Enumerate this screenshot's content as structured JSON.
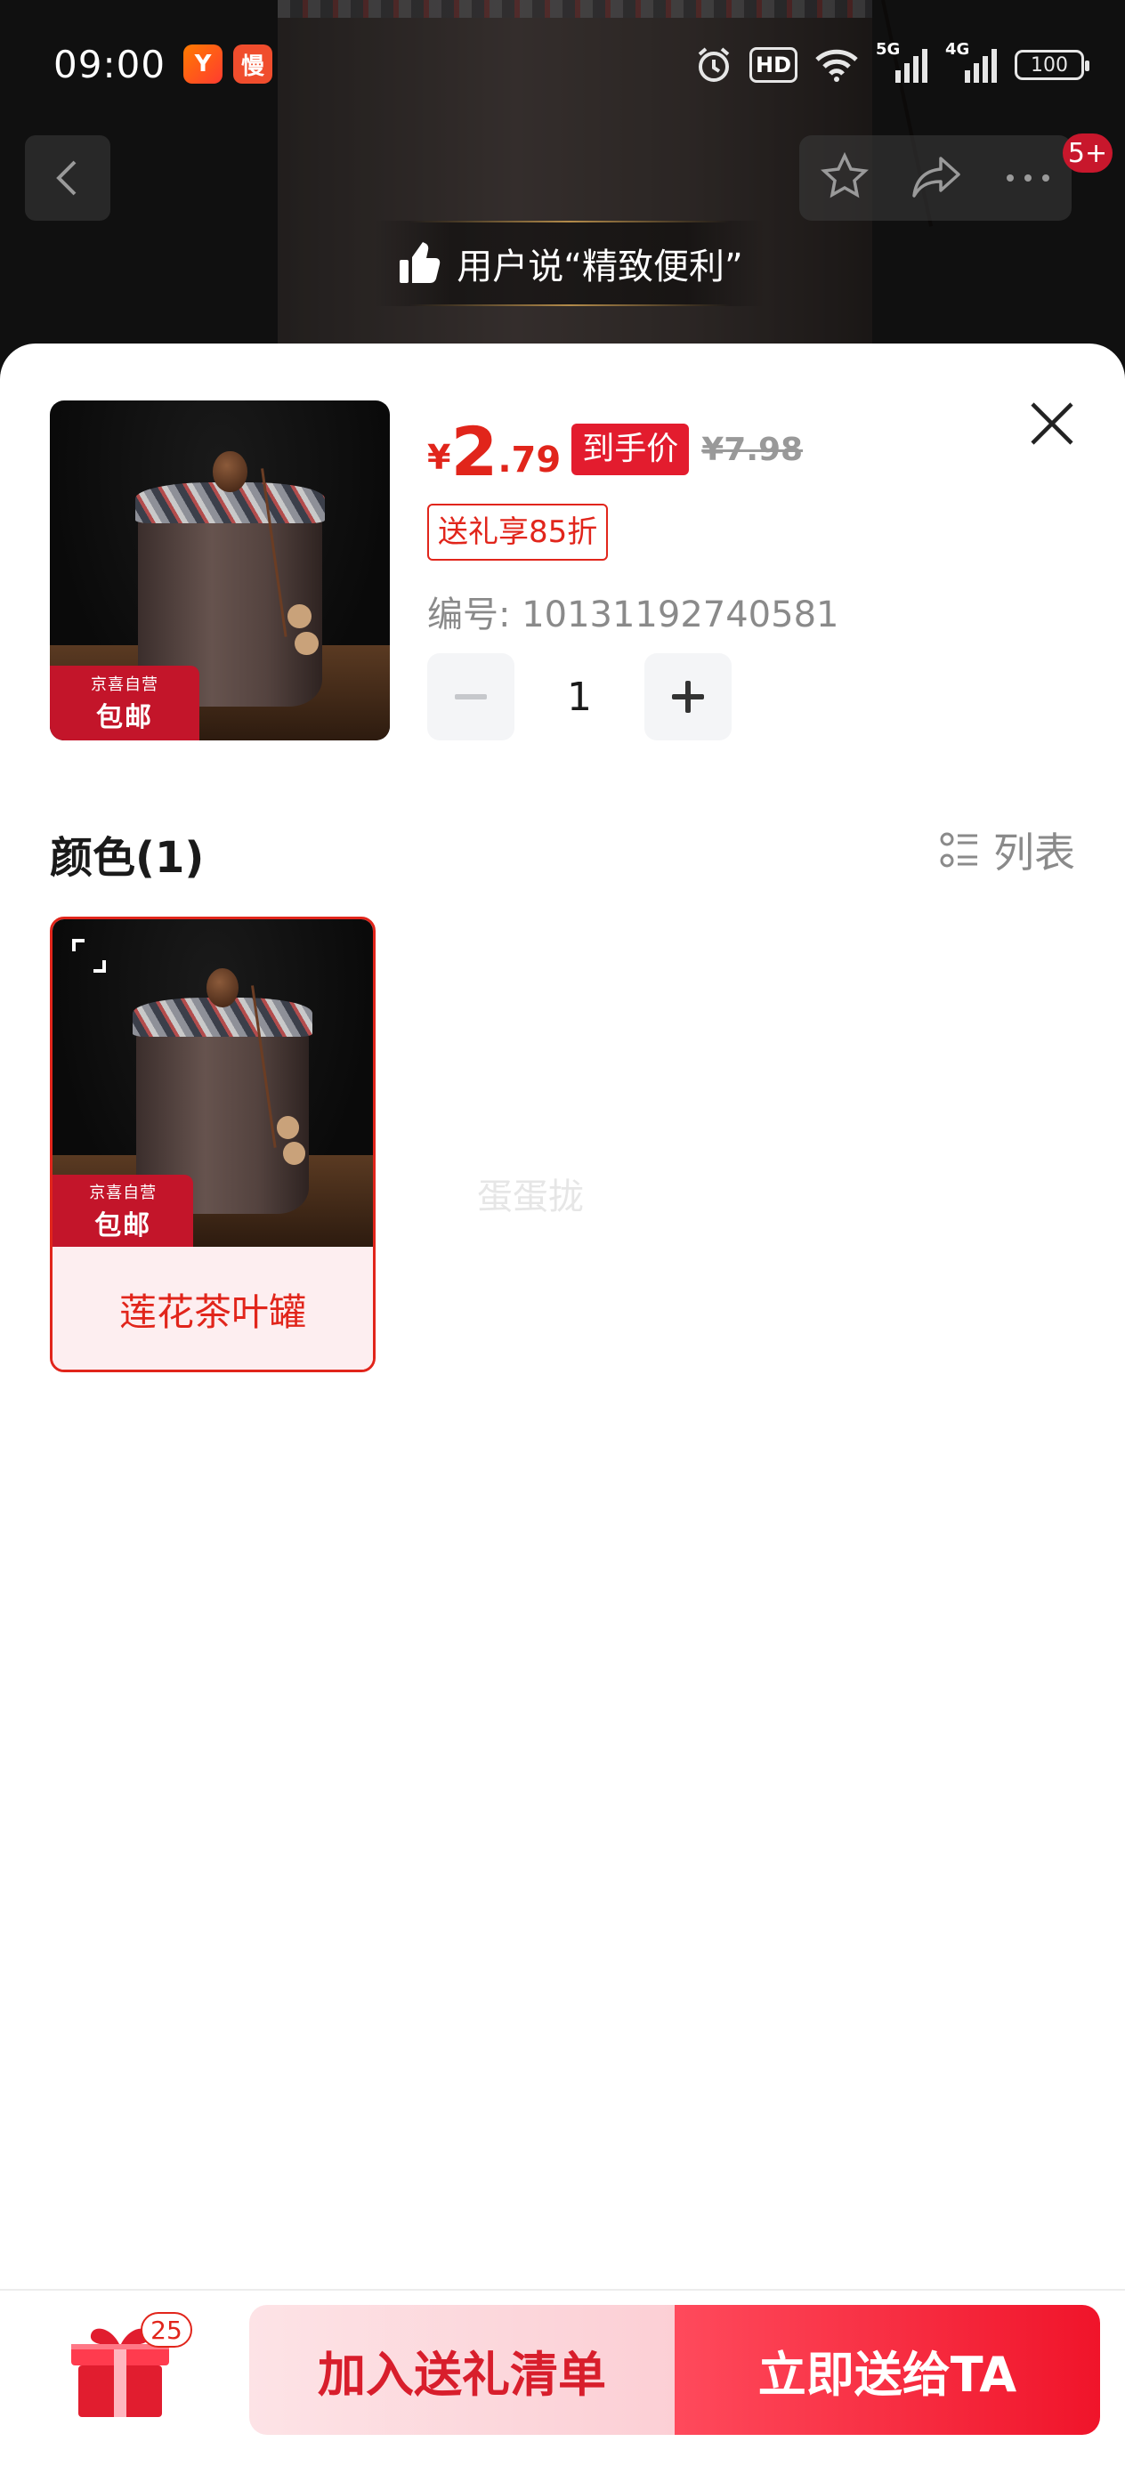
{
  "status_bar": {
    "time": "09:00",
    "app_badge_1": "Y",
    "app_badge_2": "慢",
    "network_5g": "5G",
    "network_4g": "4G",
    "hd_label": "HD",
    "battery": "100"
  },
  "header": {
    "message_badge": "5+",
    "praise_text": "用户说“精致便利”"
  },
  "product": {
    "currency": "¥",
    "price_int": "2",
    "price_dec": ".79",
    "final_price_tag": "到手价",
    "original_price": "¥7.98",
    "discount_badge": "送礼享85折",
    "sku_label": "编号: 10131192740581",
    "quantity": "1",
    "thumb_tag_line1": "京喜自营",
    "thumb_tag_line2": "包邮"
  },
  "options": {
    "section_title": "颜色(1)",
    "list_toggle_label": "列表",
    "items": [
      {
        "label": "莲花茶叶罐",
        "tag_line1": "京喜自营",
        "tag_line2": "包邮"
      }
    ]
  },
  "watermark": "蛋蛋拢",
  "bottom_bar": {
    "gift_count": "25",
    "add_to_gift_list": "加入送礼清单",
    "send_now": "立即送给TA"
  },
  "colors": {
    "accent_red": "#e1251b",
    "button_gradient_end": "#f0142a",
    "soft_pink": "#fde3e6"
  }
}
